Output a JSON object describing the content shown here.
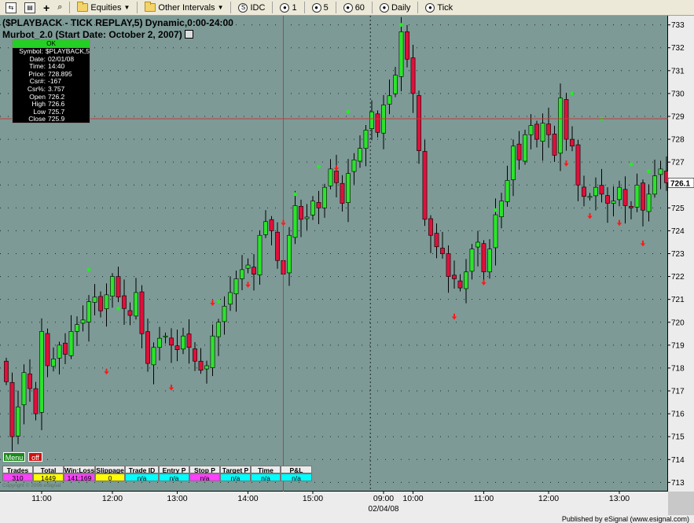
{
  "toolbar": {
    "items": [
      {
        "label": "Equities",
        "kind": "folder",
        "dropdown": true
      },
      {
        "label": "Other Intervals",
        "kind": "folder",
        "dropdown": true
      },
      {
        "label": "IDC",
        "kind": "circle",
        "glyph": "S"
      },
      {
        "label": "1",
        "kind": "circle",
        "glyph": "●"
      },
      {
        "label": "5",
        "kind": "circle",
        "glyph": "●"
      },
      {
        "label": "60",
        "kind": "circle",
        "glyph": "●"
      },
      {
        "label": "Daily",
        "kind": "circle",
        "glyph": "●"
      },
      {
        "label": "Tick",
        "kind": "circle",
        "glyph": "●"
      }
    ]
  },
  "chart": {
    "title": "($PLAYBACK - TICK REPLAY,5) Dynamic,0:00-24:00",
    "study": "Murbot_2.0 (Start Date: October 2, 2007)",
    "current_price": "726.1",
    "colors": {
      "background": "#7d9a96",
      "up": "#2ce32c",
      "down": "#e0103a",
      "signal_up": "#22ee22",
      "signal_down": "#ff1a1a",
      "crosshair": "#c43a3a"
    }
  },
  "info_box": {
    "status": "OK",
    "rows": [
      {
        "k": "Symbol:",
        "v": "$PLAYBACK,5"
      },
      {
        "k": "Date:",
        "v": "02/01/08"
      },
      {
        "k": "Time:",
        "v": "14:40"
      },
      {
        "k": "Price:",
        "v": "728.895"
      },
      {
        "k": "Csr#:",
        "v": "-167"
      },
      {
        "k": "Csr%:",
        "v": "3.757"
      },
      {
        "k": "Open",
        "v": "726.2"
      },
      {
        "k": "High",
        "v": "726.6"
      },
      {
        "k": "Low",
        "v": "725.7"
      },
      {
        "k": "Close",
        "v": "725.9"
      }
    ]
  },
  "buttons": {
    "menu": "Menu",
    "off": "off"
  },
  "stats": {
    "headers": [
      "Trades",
      "Total",
      "Win:Loss",
      "Slippage",
      "Trade ID",
      "Entry P",
      "Stop P",
      "Target P",
      "Time",
      "P&L"
    ],
    "values": [
      "310",
      "1449",
      "141:169",
      "0",
      "n/a",
      "n/a",
      "n/a",
      "n/a",
      "n/a",
      "n/a"
    ],
    "colors": [
      "#ff40ff",
      "#ffff00",
      "#ff40ff",
      "#ffff00",
      "#00ffff",
      "#00ffff",
      "#ff40ff",
      "#00ffff",
      "#00ffff",
      "#00ffff"
    ]
  },
  "copyright": "Copyright © 2006 eSignal",
  "published": "Published by eSignal (www.esignal.com)",
  "chart_data": {
    "type": "candlestick",
    "price_range": [
      712.6,
      733.4
    ],
    "price_ticks": [
      713,
      714,
      715,
      716,
      717,
      718,
      719,
      720,
      721,
      722,
      723,
      724,
      725,
      726,
      727,
      728,
      729,
      730,
      731,
      732,
      733
    ],
    "time_labels": [
      "11:00",
      "12:00",
      "13:00",
      "14:00",
      "15:00",
      "09:00",
      "10:00",
      "11:00",
      "12:00",
      "13:00"
    ],
    "date_label": "02/04/08",
    "bars": 113,
    "crosshair": {
      "bar": 47,
      "price": 728.895
    },
    "session_break_bar": 62,
    "closes": [
      717.4,
      715.0,
      716.3,
      717.8,
      717.1,
      716.0,
      719.6,
      718.1,
      718.4,
      719.0,
      718.6,
      719.6,
      719.9,
      720.1,
      720.9,
      721.1,
      720.5,
      721.2,
      722.0,
      721.1,
      720.6,
      720.3,
      721.3,
      719.5,
      718.2,
      718.9,
      719.3,
      719.4,
      719.0,
      718.8,
      719.4,
      718.9,
      718.3,
      717.9,
      718.1,
      719.4,
      720.0,
      720.7,
      721.3,
      721.9,
      722.3,
      722.5,
      722.1,
      723.8,
      724.4,
      724.0,
      722.7,
      722.1,
      723.8,
      725.1,
      724.5,
      724.6,
      725.3,
      725.0,
      725.9,
      726.7,
      726.1,
      725.2,
      726.5,
      727.1,
      727.6,
      728.4,
      729.2,
      728.3,
      729.5,
      729.9,
      730.8,
      732.7,
      731.5,
      730.0,
      727.5,
      724.5,
      723.8,
      723.3,
      723.0,
      722.0,
      721.9,
      721.5,
      722.2,
      723.2,
      723.5,
      722.2,
      723.2,
      724.7,
      725.3,
      726.2,
      727.7,
      727.1,
      728.2,
      728.6,
      728.0,
      728.7,
      728.2,
      727.3,
      729.8,
      728.0,
      727.7,
      726.0,
      725.5,
      725.5,
      725.9,
      725.6,
      725.2,
      725.3,
      725.9,
      725.1,
      725.0,
      726.0,
      724.9,
      725.6,
      726.4,
      726.7,
      726.1
    ],
    "signals_up": [
      {
        "bar": 14,
        "price": 722.3
      },
      {
        "bar": 19,
        "price": 720.6
      },
      {
        "bar": 36,
        "price": 720.9
      },
      {
        "bar": 49,
        "price": 725.6
      },
      {
        "bar": 53,
        "price": 726.8
      },
      {
        "bar": 58,
        "price": 729.2
      },
      {
        "bar": 67,
        "price": 733.0
      },
      {
        "bar": 83,
        "price": 724.9
      },
      {
        "bar": 96,
        "price": 730.0
      },
      {
        "bar": 101,
        "price": 728.9
      },
      {
        "bar": 106,
        "price": 726.9
      },
      {
        "bar": 109,
        "price": 726.6
      }
    ],
    "signals_down": [
      {
        "bar": 17,
        "price": 717.8
      },
      {
        "bar": 28,
        "price": 717.1
      },
      {
        "bar": 35,
        "price": 720.8
      },
      {
        "bar": 41,
        "price": 721.6
      },
      {
        "bar": 47,
        "price": 724.3
      },
      {
        "bar": 56,
        "price": 726.7
      },
      {
        "bar": 76,
        "price": 720.2
      },
      {
        "bar": 81,
        "price": 721.7
      },
      {
        "bar": 95,
        "price": 726.9
      },
      {
        "bar": 99,
        "price": 724.6
      },
      {
        "bar": 104,
        "price": 724.3
      },
      {
        "bar": 108,
        "price": 723.4
      }
    ]
  }
}
